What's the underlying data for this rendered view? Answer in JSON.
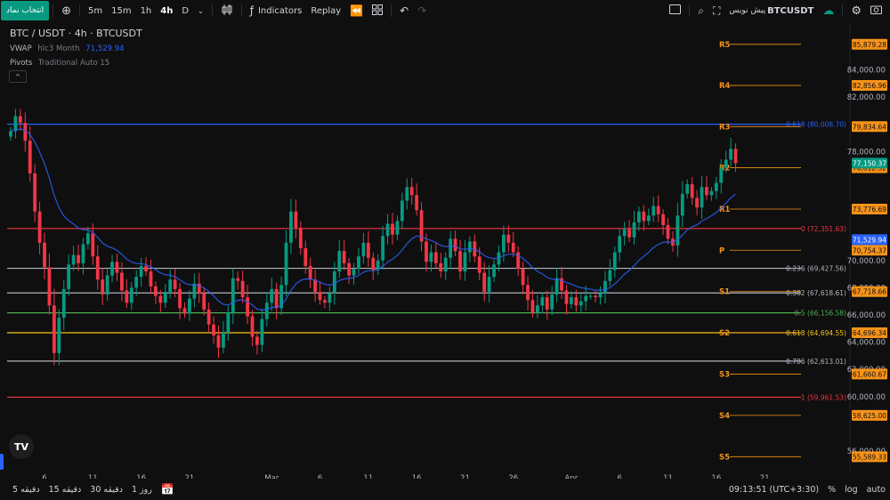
{
  "toolbar": {
    "symbol_button": "انتخاب نماد",
    "timeframes": [
      "5m",
      "15m",
      "1h",
      "4h",
      "D"
    ],
    "active_timeframe": "4h",
    "indicators_label": "Indicators",
    "replay_label": "Replay",
    "symbol_label": "BTCUSDT",
    "preview_label": "پیش نویس"
  },
  "legend": {
    "title": "BTC / USDT · 4h · BTCUSDT",
    "vwap_name": "VWAP",
    "vwap_params": "hlc3 Month",
    "vwap_value": "71,529.94",
    "pivots_name": "Pivots",
    "pivots_params": "Traditional Auto 15"
  },
  "bottom": {
    "ranges": [
      "5 دقیقه",
      "15 دقیقه",
      "30 دقیقه",
      "1 روز"
    ],
    "clock": "09:13:51 (UTC+3:30)",
    "percent": "%",
    "log": "log",
    "auto": "auto"
  },
  "chart_data": {
    "type": "candlestick",
    "symbol": "BTC / USDT",
    "interval": "4h",
    "ylim": [
      54500,
      87500
    ],
    "y_ticks": [
      {
        "v": 84000,
        "t": "84,000.00"
      },
      {
        "v": 82000,
        "t": "82,000.00"
      },
      {
        "v": 78000,
        "t": "78,000.00"
      },
      {
        "v": 70000,
        "t": "70,000.00"
      },
      {
        "v": 68000,
        "t": "68,000.00"
      },
      {
        "v": 66000,
        "t": "66,000.00"
      },
      {
        "v": 64000,
        "t": "64,000.00"
      },
      {
        "v": 62000,
        "t": "62,000.00"
      },
      {
        "v": 60000,
        "t": "60,000.00"
      },
      {
        "v": 56000,
        "t": "56,000.00"
      }
    ],
    "x_ticks": [
      {
        "i": 7,
        "t": "6"
      },
      {
        "i": 17,
        "t": "11"
      },
      {
        "i": 27,
        "t": "16"
      },
      {
        "i": 37,
        "t": "21"
      },
      {
        "i": 54,
        "t": "Mar"
      },
      {
        "i": 64,
        "t": "6"
      },
      {
        "i": 74,
        "t": "11"
      },
      {
        "i": 84,
        "t": "16"
      },
      {
        "i": 94,
        "t": "21"
      },
      {
        "i": 104,
        "t": "26"
      },
      {
        "i": 116,
        "t": "Apr"
      },
      {
        "i": 126,
        "t": "6"
      },
      {
        "i": 136,
        "t": "11"
      },
      {
        "i": 146,
        "t": "16"
      },
      {
        "i": 156,
        "t": "21"
      }
    ],
    "n_slots": 165,
    "pivots": [
      {
        "name": "R5",
        "value": 85879.28,
        "label": "85,879.28"
      },
      {
        "name": "R4",
        "value": 82856.96,
        "label": "82,856.96"
      },
      {
        "name": "R3",
        "value": 79834.64,
        "label": "79,834.64"
      },
      {
        "name": "R2",
        "value": 76812.32,
        "label": "76,812.32"
      },
      {
        "name": "R1",
        "value": 73776.69,
        "label": "73,776.69"
      },
      {
        "name": "P",
        "value": 70754.37,
        "label": "70,754.37"
      },
      {
        "name": "S1",
        "value": 67718.66,
        "label": "67,718.66"
      },
      {
        "name": "S2",
        "value": 64696.34,
        "label": "64,696.34"
      },
      {
        "name": "S3",
        "value": 61660.67,
        "label": "61,660.67"
      },
      {
        "name": "S4",
        "value": 58625.0,
        "label": "58,625.00"
      },
      {
        "name": "S5",
        "value": 55589.33,
        "label": "55,589.33"
      }
    ],
    "fib_levels": [
      {
        "ratio": "0.618",
        "value": 80008.7,
        "label": "0.618 (80,008.70)",
        "color": "#2962ff"
      },
      {
        "ratio": "0",
        "value": 72351.63,
        "label": "0 (72,351.63)",
        "color": "#f23645"
      },
      {
        "ratio": "0.236",
        "value": 69427.56,
        "label": "0.236 (69,427.56)",
        "color": "#b2b5be"
      },
      {
        "ratio": "0.382",
        "value": 67618.61,
        "label": "0.382 (67,618.61)",
        "color": "#b2b5be"
      },
      {
        "ratio": "0.5",
        "value": 66156.58,
        "label": "0.5 (66,156.58)",
        "color": "#4caf50"
      },
      {
        "ratio": "0.618",
        "value": 64694.55,
        "label": "0.618 (64,694.55)",
        "color": "#f5c518"
      },
      {
        "ratio": "0.786",
        "value": 62613.01,
        "label": "0.786 (62,613.01)",
        "color": "#b2b5be"
      },
      {
        "ratio": "1",
        "value": 59961.53,
        "label": "1 (59,961.53)",
        "color": "#f23645"
      }
    ],
    "last_price": {
      "value": 77150.37,
      "label": "77,150.37"
    },
    "vwap": {
      "value": 71529.94,
      "label": "71,529.94"
    },
    "close_series": [
      79500,
      80600,
      80100,
      78800,
      76400,
      73600,
      71300,
      69500,
      66700,
      63200,
      65800,
      67900,
      69700,
      70400,
      69800,
      71200,
      72000,
      70300,
      68600,
      67500,
      68900,
      69900,
      69100,
      67800,
      66900,
      68000,
      68800,
      69600,
      69200,
      68100,
      67400,
      66900,
      67700,
      68600,
      67900,
      66500,
      66100,
      67200,
      68300,
      67600,
      66400,
      65300,
      64500,
      63600,
      64700,
      66200,
      68700,
      68500,
      67300,
      65900,
      64400,
      63800,
      65700,
      66900,
      67900,
      66500,
      68200,
      71300,
      73600,
      72400,
      70900,
      69600,
      68600,
      67700,
      67100,
      66900,
      67600,
      69200,
      70700,
      69800,
      68900,
      69400,
      70300,
      71300,
      70200,
      69300,
      70000,
      71800,
      72700,
      71900,
      72900,
      74400,
      75400,
      74800,
      73700,
      71400,
      69900,
      70600,
      69800,
      69200,
      70200,
      71600,
      70700,
      69200,
      70600,
      71400,
      70300,
      69100,
      67700,
      68800,
      69700,
      70600,
      71900,
      71300,
      70600,
      69400,
      68200,
      67100,
      66200,
      66700,
      67300,
      66400,
      67500,
      68700,
      67800,
      66800,
      67300,
      66700,
      67000,
      67400,
      67400,
      67300,
      67600,
      68500,
      69300,
      70600,
      71800,
      72300,
      71700,
      72800,
      73600,
      72900,
      73300,
      74000,
      73400,
      72600,
      71600,
      71100,
      73300,
      74900,
      75600,
      74600,
      73900,
      75400,
      74800,
      75100,
      75700,
      76800,
      77400,
      78200,
      77150
    ],
    "candle_color_up": "#089981",
    "candle_color_down": "#f23645"
  }
}
